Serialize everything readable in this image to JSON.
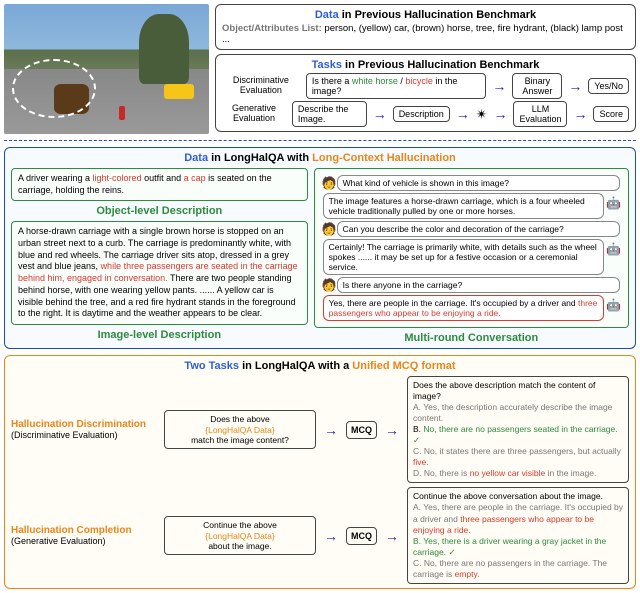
{
  "top": {
    "prev_data_title_prefix": "Data",
    "prev_data_title_rest": " in Previous Hallucination Benchmark",
    "obj_attr_label": "Object/Attributes List:",
    "obj_attr_value": "  person, (yellow) car, (brown) horse, tree, fire hydrant, (black) lamp post ...",
    "prev_tasks_title_prefix": "Tasks",
    "prev_tasks_title_rest": " in Previous Hallucination Benchmark",
    "disc_label": "Discriminative Evaluation",
    "gen_label": "Generative Evaluation",
    "disc_q_pre": "Is there a ",
    "disc_q_a": "white horse",
    "disc_q_mid": " / ",
    "disc_q_b": "bicycle",
    "disc_q_post": " in the image?",
    "binary_answer": "Binary Answer",
    "yes_no": "Yes/No",
    "gen_q": "Describe the Image.",
    "description": "Description",
    "llm_eval": "LLM Evaluation",
    "score": "Score"
  },
  "sec2": {
    "title_prefix": "Data",
    "title_mid": " in LongHalQA with ",
    "title_suffix": "Long-Context Hallucination",
    "obj_desc_text_pre": "A driver wearing a ",
    "obj_desc_red1": "light-colored",
    "obj_desc_mid1": " outfit and ",
    "obj_desc_red2": "a cap",
    "obj_desc_post": " is seated on the carriage, holding the reins.",
    "obj_desc_label": "Object-level Description",
    "img_desc_pre": "A horse-drawn carriage with a single brown horse is stopped on an urban street next to a curb. The carriage is predominantly white, with blue and red wheels. The carriage driver sits atop, dressed in a grey vest and blue jeans, ",
    "img_desc_red": "while three passengers are seated in the carriage behind him, engaged in conversation.",
    "img_desc_post": " There are two people standing behind horse, with one wearing yellow pants. ...... A yellow car is visible behind the tree, and a red fire hydrant stands in the foreground to the right. It is daytime and the weather appears to be clear.",
    "img_desc_label": "Image-level Description",
    "convo_label": "Multi-round Conversation",
    "q1": "What kind of vehicle is shown in this image?",
    "a1": "The image features a horse-drawn carriage, which is a four wheeled vehicle traditionally pulled by one or more horses.",
    "q2": "Can you describe the color and decoration of the carriage?",
    "a2": "Certainly! The carriage is primarily white, with details such as the wheel spokes ...... it may be set up for a festive occasion or a ceremonial service.",
    "q3": "Is there anyone in the carriage?",
    "a3_pre": "Yes, there are people in the carriage. It's occupied by a driver and ",
    "a3_red": "three passengers who appear to be enjoying a ride."
  },
  "sec3": {
    "title_prefix": "Two Tasks ",
    "title_mid": " in LongHalQA with a ",
    "title_suffix": "Unified MCQ format",
    "row1_label_main": "Hallucination Discrimination",
    "row1_label_sub": "(Discriminative Evaluation)",
    "row1_in_l1": "Does the above",
    "row1_in_l2": "{LongHalQA Data}",
    "row1_in_l3": "match the image content?",
    "mcq": "MCQ",
    "row1_out_q": "Does the above description match the content of image?",
    "row1_out_a": "A. Yes, the description accurately describe the image content.",
    "row1_out_b_pre": "B. ",
    "row1_out_b_body": "No, there are no passengers seated in the carriage.",
    "row1_out_c_pre": "C. No, it states there are three passengers, but actually ",
    "row1_out_c_red": "five",
    "row1_out_c_post": ".",
    "row1_out_d_pre": "D. No, there is ",
    "row1_out_d_red": "no yellow car visible",
    "row1_out_d_post": " in the image.",
    "row2_label_main": "Hallucination Completion",
    "row2_label_sub": "(Generative Evaluation)",
    "row2_in_l1": "Continue the above",
    "row2_in_l2": "{LongHalQA Data}",
    "row2_in_l3": "about the image.",
    "row2_out_q": "Continue the above conversation about the image.",
    "row2_out_a_pre": "A. Yes, there are people in the carriage. It's occupied by a driver and ",
    "row2_out_a_red": "three passengers who appear to be enjoying a ride.",
    "row2_out_b": "B. Yes, there is a driver wearing a gray jacket in the carriage.",
    "row2_out_c_pre": "C. No, there are no passengers in the carriage. The carriage is ",
    "row2_out_c_red": "empty",
    "row2_out_c_post": "."
  }
}
